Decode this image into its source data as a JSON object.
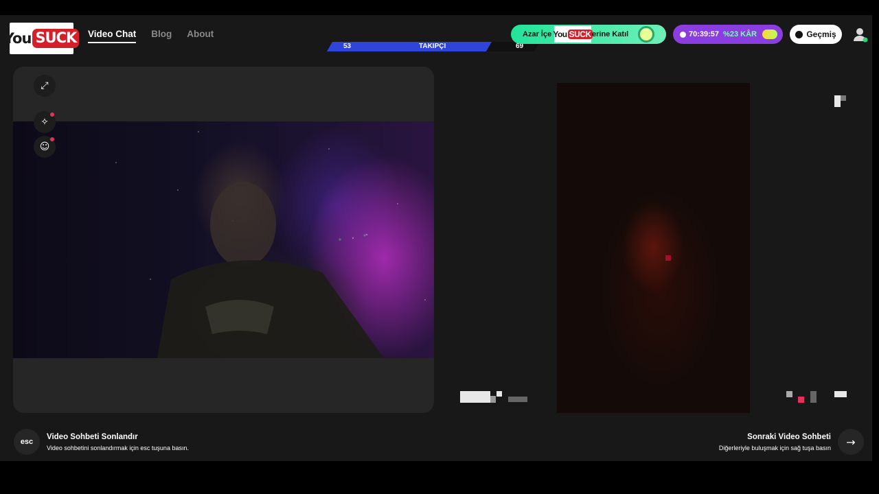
{
  "brand": {
    "logo_text": "You",
    "logo_box": "SUCK"
  },
  "nav": {
    "items": [
      {
        "label": "Video Chat",
        "active": true
      },
      {
        "label": "Blog",
        "active": false
      },
      {
        "label": "About",
        "active": false
      }
    ]
  },
  "followers": {
    "left_count": "53",
    "label": "TAKIPÇI",
    "right_count": "69"
  },
  "promo": {
    "text_before": "Azar İçe",
    "mini_logo_text": "You",
    "mini_logo_box": "SUCK",
    "text_after": "erine Katıl"
  },
  "timer": {
    "time": "70:39:57",
    "profit": "%23 KÂR"
  },
  "history": {
    "label": "Geçmiş"
  },
  "footer": {
    "end": {
      "key": "esc",
      "title": "Video Sohbeti Sonlandır",
      "subtitle": "Video sohbetini sonlandırmak için esc tuşuna basın."
    },
    "next": {
      "title": "Sonraki Video Sohbeti",
      "subtitle": "Diğerleriyle buluşmak için sağ tuşa basın"
    }
  },
  "colors": {
    "accent_blue": "#2f45d9",
    "promo_green": "#22e39a",
    "timer_purple": "#8a3ee0",
    "logo_red": "#d4202a"
  }
}
